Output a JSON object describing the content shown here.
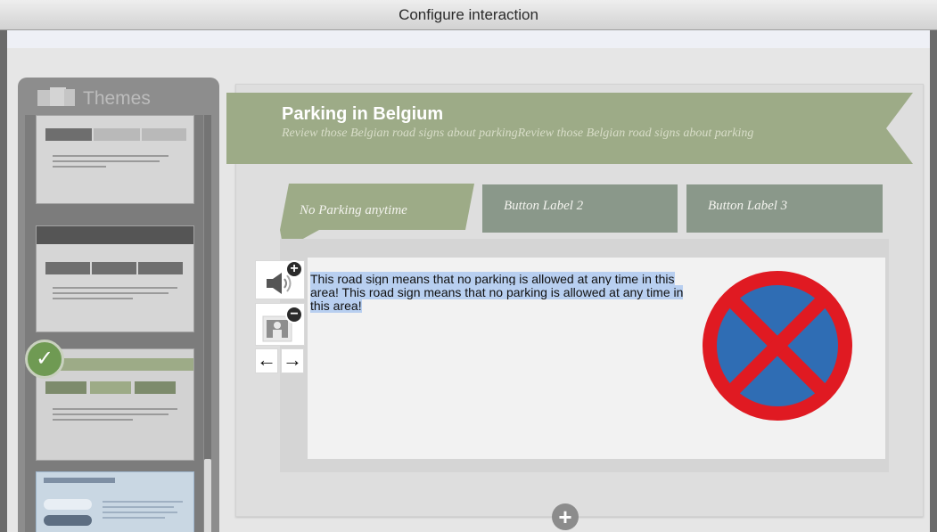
{
  "window": {
    "title": "Configure interaction"
  },
  "themes": {
    "label": "Themes"
  },
  "header": {
    "title": "Parking in Belgium",
    "subtitle": "Review those Belgian road signs about parkingReview those Belgian road signs about parking"
  },
  "tabs": [
    {
      "label": "No Parking anytime",
      "active": true
    },
    {
      "label": "Button Label 2",
      "active": false
    },
    {
      "label": "Button Label 3",
      "active": false
    }
  ],
  "content": {
    "text": "This road sign means that no parking is allowed at any time in this area! This road sign means that no parking is allowed at any time in this area!"
  },
  "icons": {
    "audio": "speaker-icon",
    "image": "image-icon",
    "add_badge": "plus-icon",
    "remove_badge": "minus-icon",
    "prev": "arrow-left-icon",
    "next": "arrow-right-icon",
    "add_item": "plus-circle-icon",
    "selected": "checkmark-icon",
    "sign": "no-parking-sign-icon"
  },
  "glyphs": {
    "plus": "+",
    "minus": "−",
    "left": "←",
    "right": "→",
    "check": "✓"
  },
  "colors": {
    "banner": "#9dab87",
    "tab": "#8a988a",
    "highlight": "#b8cff0",
    "sign_blue": "#2f6db4",
    "sign_red": "#e01a22"
  }
}
